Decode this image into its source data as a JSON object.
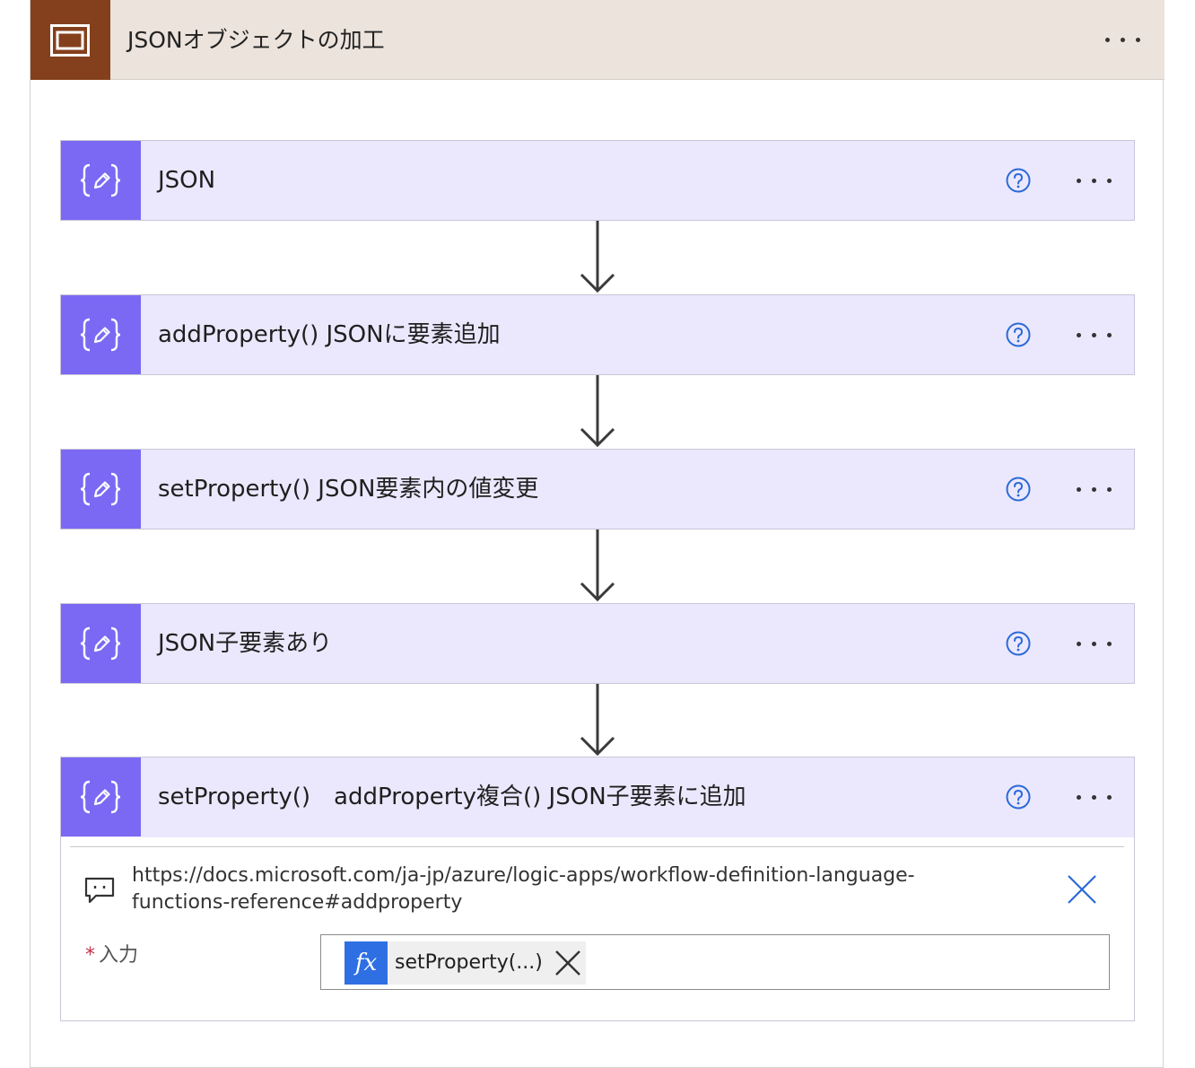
{
  "scope": {
    "title": "JSONオブジェクトの加工",
    "icon": "scope-icon",
    "accent_color": "#84401c",
    "header_color": "#ece3dc"
  },
  "action_color": "#7b69f4",
  "action_bg": "#ebe8fd",
  "actions": [
    {
      "title": "JSON",
      "icon": "compose-icon"
    },
    {
      "title": "addProperty() JSONに要素追加",
      "icon": "compose-icon"
    },
    {
      "title": "setProperty() JSON要素内の値変更",
      "icon": "compose-icon"
    },
    {
      "title": "JSON子要素あり",
      "icon": "compose-icon"
    }
  ],
  "expanded_action": {
    "title": "setProperty()　addProperty複合() JSON子要素に追加",
    "icon": "compose-icon",
    "comment": "https://docs.microsoft.com/ja-jp/azure/logic-apps/workflow-definition-language-functions-reference#addproperty",
    "field": {
      "required_mark": "*",
      "label": "入力",
      "token": {
        "fx_label": "fx",
        "text": "setProperty(...)"
      }
    }
  }
}
